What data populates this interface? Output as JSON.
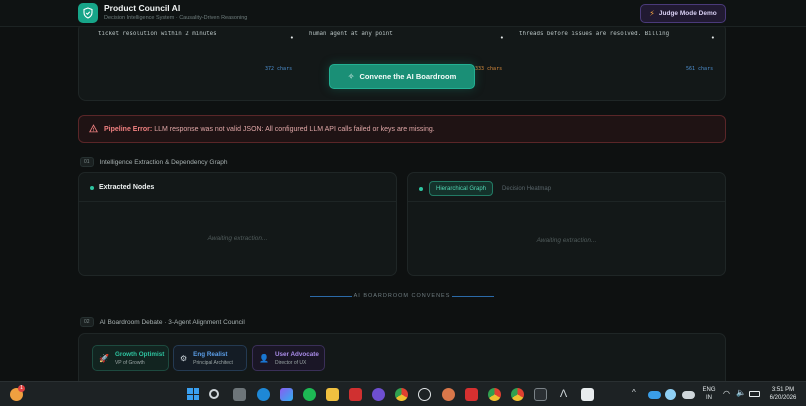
{
  "header": {
    "title": "Product Council AI",
    "subtitle": "Decision Intelligence System · Causality-Driven Reasoning",
    "judge_button": "Judge Mode Demo"
  },
  "inputs": [
    {
      "text": "ticket resolution within 2 minutes",
      "chars": "372 chars",
      "color": "#4d8fcf"
    },
    {
      "text": "human agent at any point",
      "chars": "333 chars",
      "color": "#d98a3c"
    },
    {
      "text": "threads before issues are resolved. Billing",
      "chars": "561 chars",
      "color": "#4d8fcf"
    }
  ],
  "convene_button": "Convene the AI Boardroom",
  "error": {
    "label": "Pipeline Error:",
    "message": "LLM response was not valid JSON: All configured LLM API calls failed or keys are missing."
  },
  "section1": {
    "num": "01",
    "title": "Intelligence Extraction & Dependency Graph"
  },
  "nodes_panel": {
    "title": "Extracted Nodes",
    "placeholder": "Awaiting extraction..."
  },
  "graph_panel": {
    "tab_active": "Hierarchical Graph",
    "tab_inactive": "Decision Heatmap",
    "placeholder": "Awaiting extraction..."
  },
  "convenes_label": "AI BOARDROOM CONVENES",
  "section2": {
    "num": "02",
    "title": "AI Boardroom Debate · 3-Agent Alignment Council"
  },
  "agents": [
    {
      "name": "Growth Optimist",
      "role": "VP of Growth",
      "color": "#2ec4a0",
      "icon": "rocket-icon"
    },
    {
      "name": "Eng Realist",
      "role": "Principal Architect",
      "color": "#5b9ee8",
      "icon": "gear-icon"
    },
    {
      "name": "User Advocate",
      "role": "Director of UX",
      "color": "#a98be8",
      "icon": "user-icon"
    }
  ],
  "taskbar": {
    "lang_top": "ENG",
    "lang_bottom": "IN",
    "time": "3:51 PM",
    "date": "6/20/2026",
    "weather_badge": "1"
  }
}
